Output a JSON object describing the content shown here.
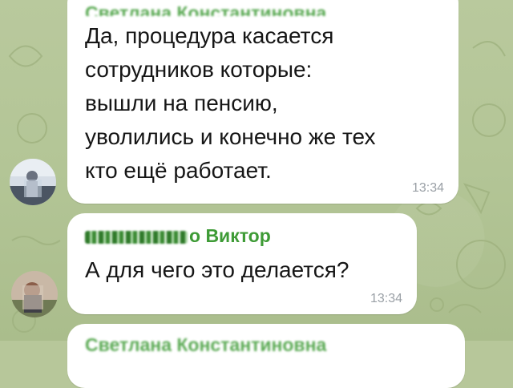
{
  "messages": [
    {
      "sender": "Светлана Константиновна",
      "lines": [
        "Да, процедура касается",
        "сотрудников которые:",
        "вышли на пенсию,",
        "уволились и конечно же тех",
        "кто ещё работает."
      ],
      "time": "13:34"
    },
    {
      "sender_visible": "о Виктор",
      "text": "А для чего это делается?",
      "time": "13:34"
    },
    {
      "sender": "Светлана Константиновна"
    }
  ],
  "colors": {
    "wallpaper": "#b7c79a",
    "bubble": "#ffffff",
    "sender_name": "#3e9b36",
    "time": "#9aa0a6"
  }
}
